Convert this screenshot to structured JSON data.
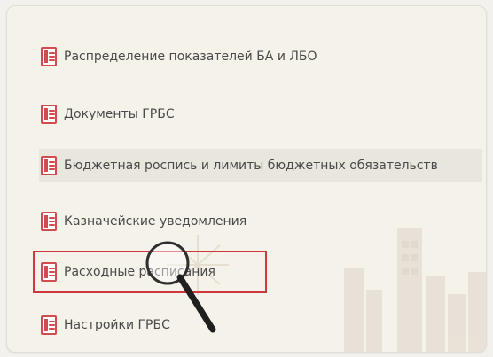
{
  "menu": {
    "items": [
      {
        "label": "Распределение показателей БА и ЛБО",
        "icon": "document-icon"
      },
      {
        "label": "Документы ГРБС",
        "icon": "document-icon"
      },
      {
        "label": "Бюджетная роспись и лимиты бюджетных обязательств",
        "icon": "document-icon"
      },
      {
        "label": "Казначейские уведомления",
        "icon": "document-icon"
      },
      {
        "label": "Расходные расписания",
        "icon": "document-icon"
      },
      {
        "label": "Настройки ГРБС",
        "icon": "document-icon"
      }
    ]
  },
  "colors": {
    "panel_bg": "#f5f2ea",
    "highlight_bg": "#e9e6de",
    "text": "#4a4a4a",
    "icon_red": "#d14b4f",
    "focus_border": "#d1363c"
  },
  "overlay": {
    "magnifier_icon": "magnifier-icon"
  }
}
